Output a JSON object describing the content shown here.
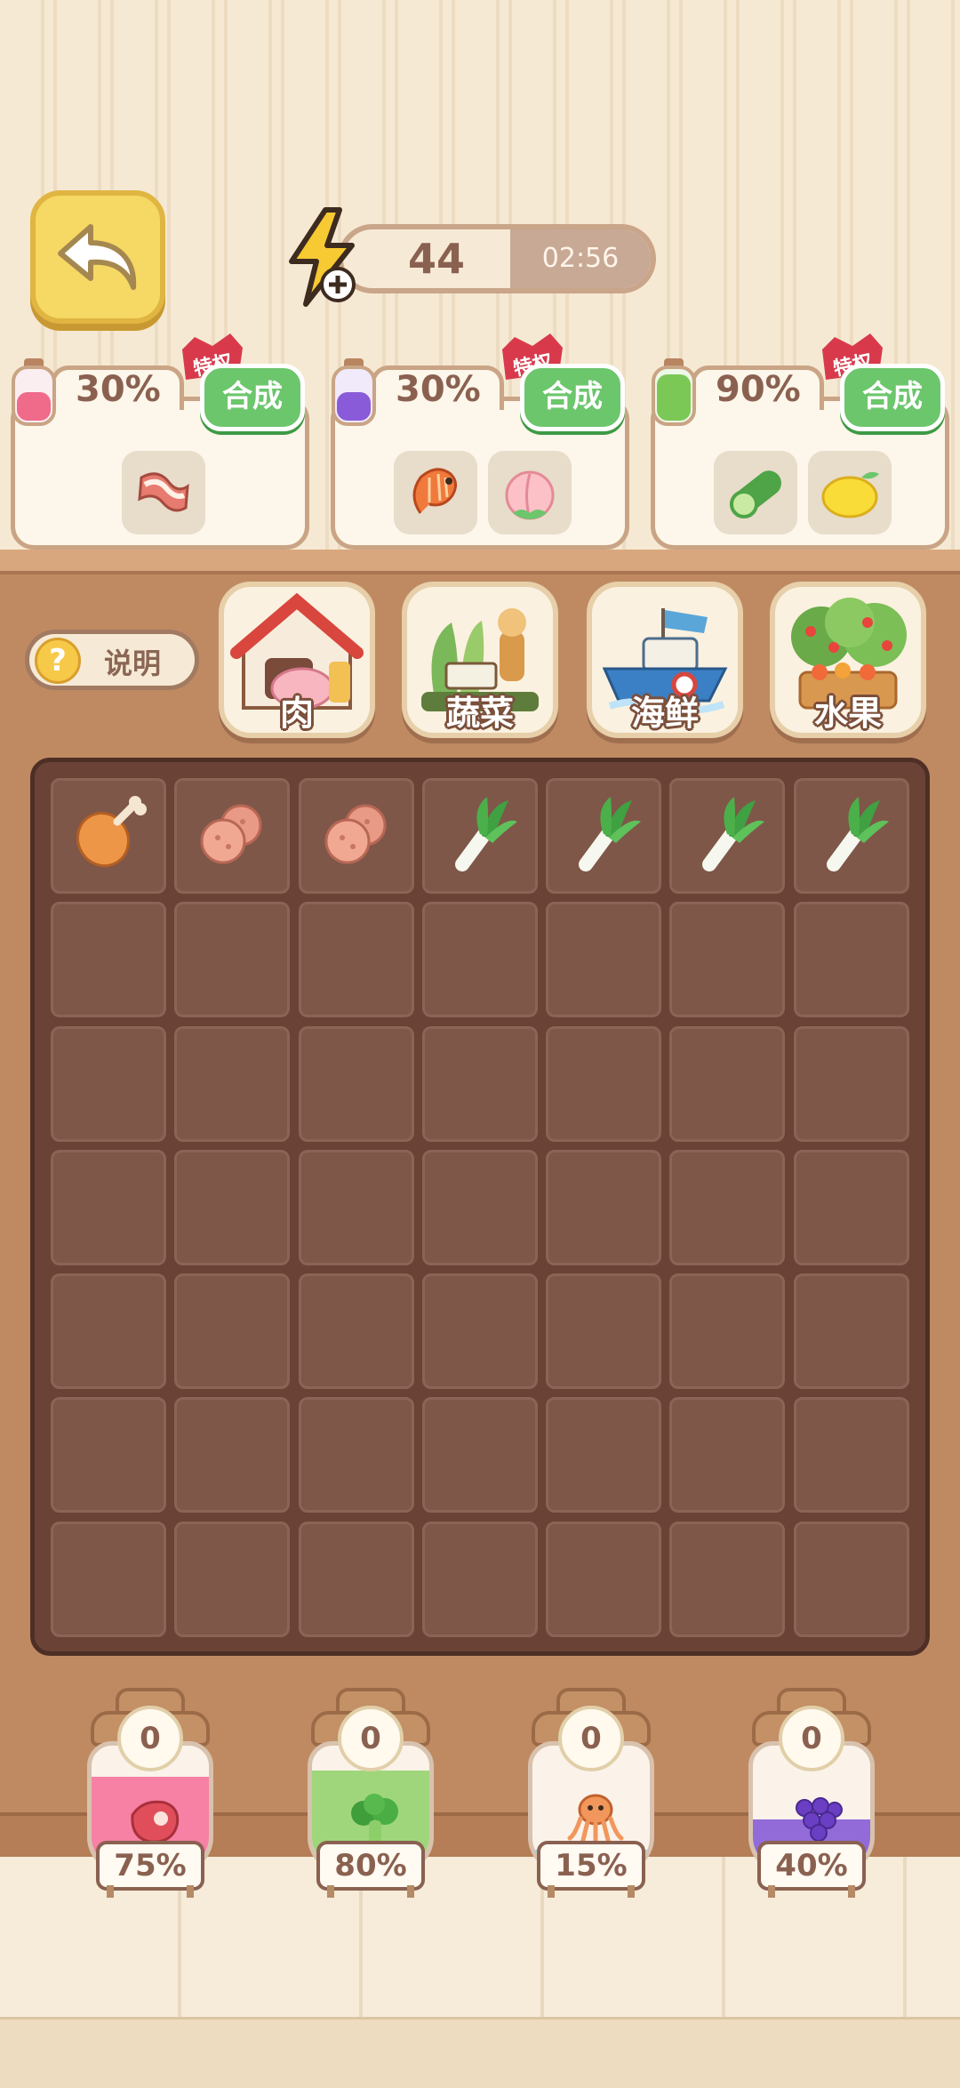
{
  "energy": {
    "value": "44",
    "timer": "02:56"
  },
  "top_jars": [
    {
      "percent": "30%",
      "button": "合成",
      "badge": "特权",
      "color": "#f06a8a",
      "items": [
        "bacon-icon"
      ]
    },
    {
      "percent": "30%",
      "button": "合成",
      "badge": "特权",
      "color": "#8a5bd8",
      "items": [
        "shrimp-icon",
        "peach-icon"
      ]
    },
    {
      "percent": "90%",
      "button": "合成",
      "badge": "特权",
      "color": "#7cc857",
      "items": [
        "cucumber-icon",
        "lemon-icon"
      ]
    }
  ],
  "help": {
    "label": "说明"
  },
  "categories": [
    {
      "name": "肉",
      "icon": "barn-pig-icon"
    },
    {
      "name": "蔬菜",
      "icon": "vegetable-garden-icon"
    },
    {
      "name": "海鲜",
      "icon": "fishing-boat-icon"
    },
    {
      "name": "水果",
      "icon": "fruit-tree-icon"
    }
  ],
  "board": {
    "rows": 7,
    "cols": 7,
    "first_row": [
      "drumstick-icon",
      "meatball-icon",
      "meatball-icon",
      "leek-icon",
      "leek-icon",
      "leek-icon",
      "leek-icon"
    ]
  },
  "bottom_jars": [
    {
      "count": "0",
      "percent": "75%",
      "level": 0.75,
      "color": "#f46c98",
      "icon": "steak-icon"
    },
    {
      "count": "0",
      "percent": "80%",
      "level": 0.8,
      "color": "#8fd067",
      "icon": "broccoli-icon"
    },
    {
      "count": "0",
      "percent": "15%",
      "level": 0.15,
      "color": "#8cc6ec",
      "icon": "octopus-icon"
    },
    {
      "count": "0",
      "percent": "40%",
      "level": 0.4,
      "color": "#8052d6",
      "icon": "grapes-icon"
    }
  ]
}
